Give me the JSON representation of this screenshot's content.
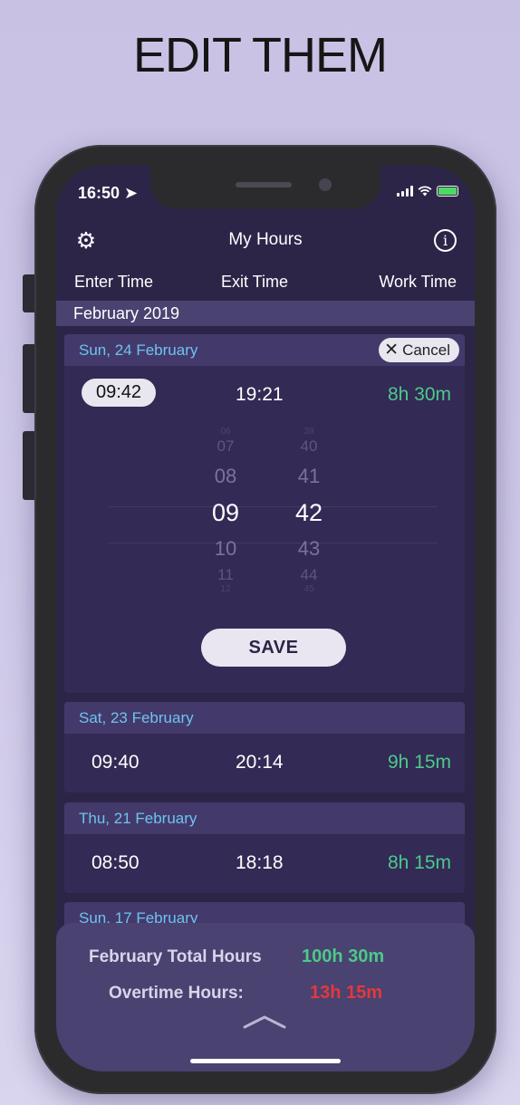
{
  "headline": "EDIT THEM",
  "status": {
    "time": "16:50 ➤"
  },
  "app": {
    "title": "My Hours",
    "columns": [
      "Enter Time",
      "Exit Time",
      "Work Time"
    ],
    "month": "February 2019"
  },
  "editing": {
    "date": "Sun, 24 February",
    "cancel_label": "Cancel",
    "enter": "09:42",
    "exit": "19:21",
    "work": "8h 30m",
    "picker": {
      "hours": [
        "06",
        "07",
        "08",
        "09",
        "10",
        "11",
        "12"
      ],
      "minutes": [
        "39",
        "40",
        "41",
        "42",
        "43",
        "44",
        "45"
      ],
      "selected_hour": "09",
      "selected_minute": "42"
    },
    "save_label": "SAVE"
  },
  "entries": [
    {
      "date": "Sat, 23 February",
      "enter": "09:40",
      "exit": "20:14",
      "work": "9h 15m"
    },
    {
      "date": "Thu, 21 February",
      "enter": "08:50",
      "exit": "18:18",
      "work": "8h 15m"
    },
    {
      "date": "Sun, 17 February"
    }
  ],
  "summary": {
    "total_label": "February Total Hours",
    "total_value": "100h 30m",
    "overtime_label": "Overtime Hours:",
    "overtime_value": "13h 15m"
  },
  "colors": {
    "work_time": "#4cc98a",
    "overtime": "#e0393e",
    "date_header": "#6ec3f0",
    "background": "#2d2548"
  }
}
